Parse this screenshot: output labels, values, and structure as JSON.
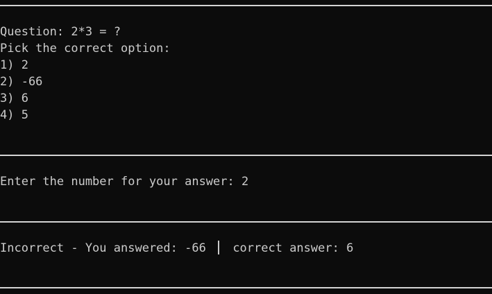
{
  "question": {
    "prompt": "Question: 2*3 = ?",
    "instruction": "Pick the correct option:",
    "options": [
      "1) 2",
      "2) -66",
      "3) 6",
      "4) 5"
    ]
  },
  "input": {
    "prompt": "Enter the number for your answer: ",
    "value": "2"
  },
  "result": {
    "status": "Incorrect - You answered: -66",
    "correct": "correct answer: 6"
  }
}
